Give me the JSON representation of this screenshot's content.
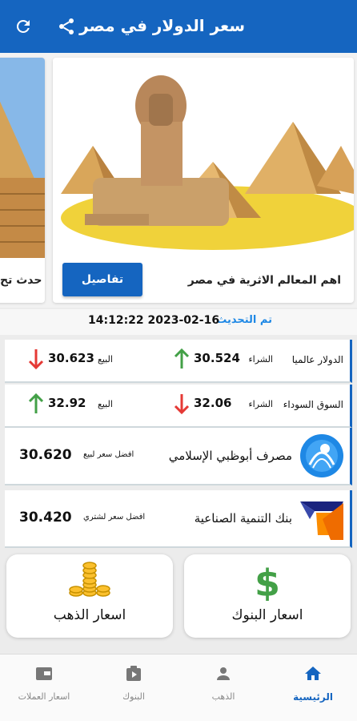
{
  "app": {
    "title": "سعر الدولار في مصر",
    "accent": "#1565c0"
  },
  "toolbar": {
    "refresh_icon": "refresh-icon",
    "share_icon": "share-icon"
  },
  "carousel": {
    "main": {
      "caption": "اهم المعالم الاثرية في مصر",
      "button": "تفاصيل"
    },
    "side": {
      "caption": "حدث تح"
    }
  },
  "update": {
    "label": "تم التحديث",
    "time": "14:12:22 2023-02-16"
  },
  "rates": [
    {
      "label": "الدولار عالميا",
      "buy_label": "الشراء",
      "buy_value": "30.524",
      "buy_trend": "up",
      "sell_label": "البيع",
      "sell_value": "30.623",
      "sell_trend": "down"
    },
    {
      "label": "السوق السوداء",
      "buy_label": "الشراء",
      "buy_value": "32.06",
      "buy_trend": "down",
      "sell_label": "البيع",
      "sell_value": "32.92",
      "sell_trend": "up"
    }
  ],
  "banks": [
    {
      "name": "مصرف أبوظبي الإسلامي",
      "best_label": "افضل سعر لبيع",
      "best_value": "30.620",
      "logo": "adib-logo"
    },
    {
      "name": "بنك التنمية الصناعية",
      "best_label": "افضل سعر لشتري",
      "best_value": "30.420",
      "logo": "idb-logo"
    }
  ],
  "tiles": {
    "gold": {
      "label": "اسعار الذهب",
      "icon": "gold-coins-icon"
    },
    "banks": {
      "label": "اسعار البنوك",
      "icon": "dollar-icon"
    }
  },
  "nav": {
    "home": "الرئيسية",
    "gold": "الذهب",
    "banks": "البنوك",
    "currencies": "اسعار العملات"
  },
  "colors": {
    "up": "#43a047",
    "down": "#e53935",
    "link": "#1e88e5"
  }
}
